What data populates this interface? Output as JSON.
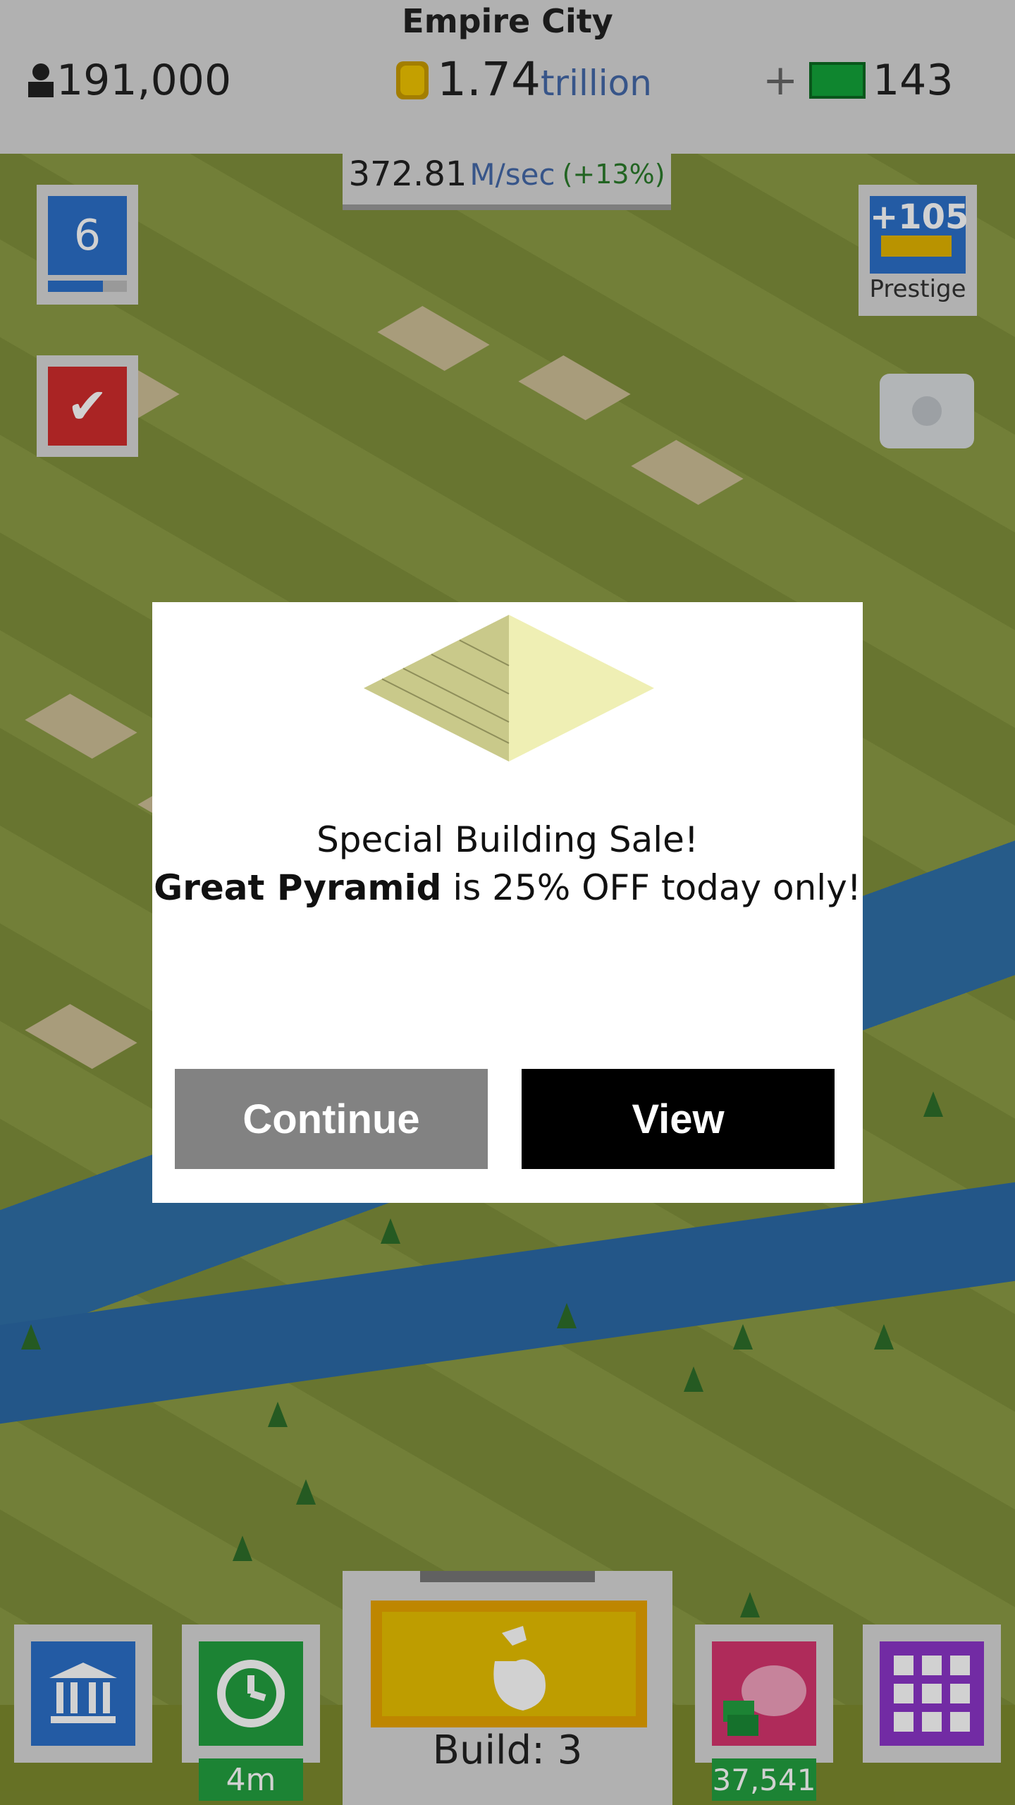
{
  "header": {
    "city_name": "Empire City",
    "population": "191,000",
    "coins_value": "1.74",
    "coins_unit": "trillion",
    "plus": "+",
    "gems": "143",
    "rate_value": "372.81",
    "rate_unit": "M/sec",
    "rate_bonus": "(+13%)"
  },
  "side": {
    "level": "6",
    "level_progress": 0.7,
    "prestige_value": "+105",
    "prestige_label": "Prestige"
  },
  "modal": {
    "line1": "Special Building Sale!",
    "building_name": "Great Pyramid",
    "line2_rest": " is 25% OFF today only!",
    "continue_label": "Continue",
    "view_label": "View"
  },
  "bottom": {
    "timer": "4m",
    "build_label": "Build: 3",
    "savings": "37,541"
  },
  "colors": {
    "blue": "#2b6fc8",
    "green": "#23a040",
    "red": "#d02c2c",
    "purple": "#8b35c9",
    "pink": "#d6356e",
    "yellow": "#e8c000"
  },
  "icons": {
    "population": "person-icon",
    "coins": "coin-icon",
    "gems": "cash-icon",
    "check": "checkmark-icon",
    "camera": "camera-icon",
    "bank": "bank-icon",
    "clock": "clock-icon",
    "build": "hammer-hand-icon",
    "pig": "piggy-bank-icon",
    "grid": "grid-menu-icon"
  }
}
